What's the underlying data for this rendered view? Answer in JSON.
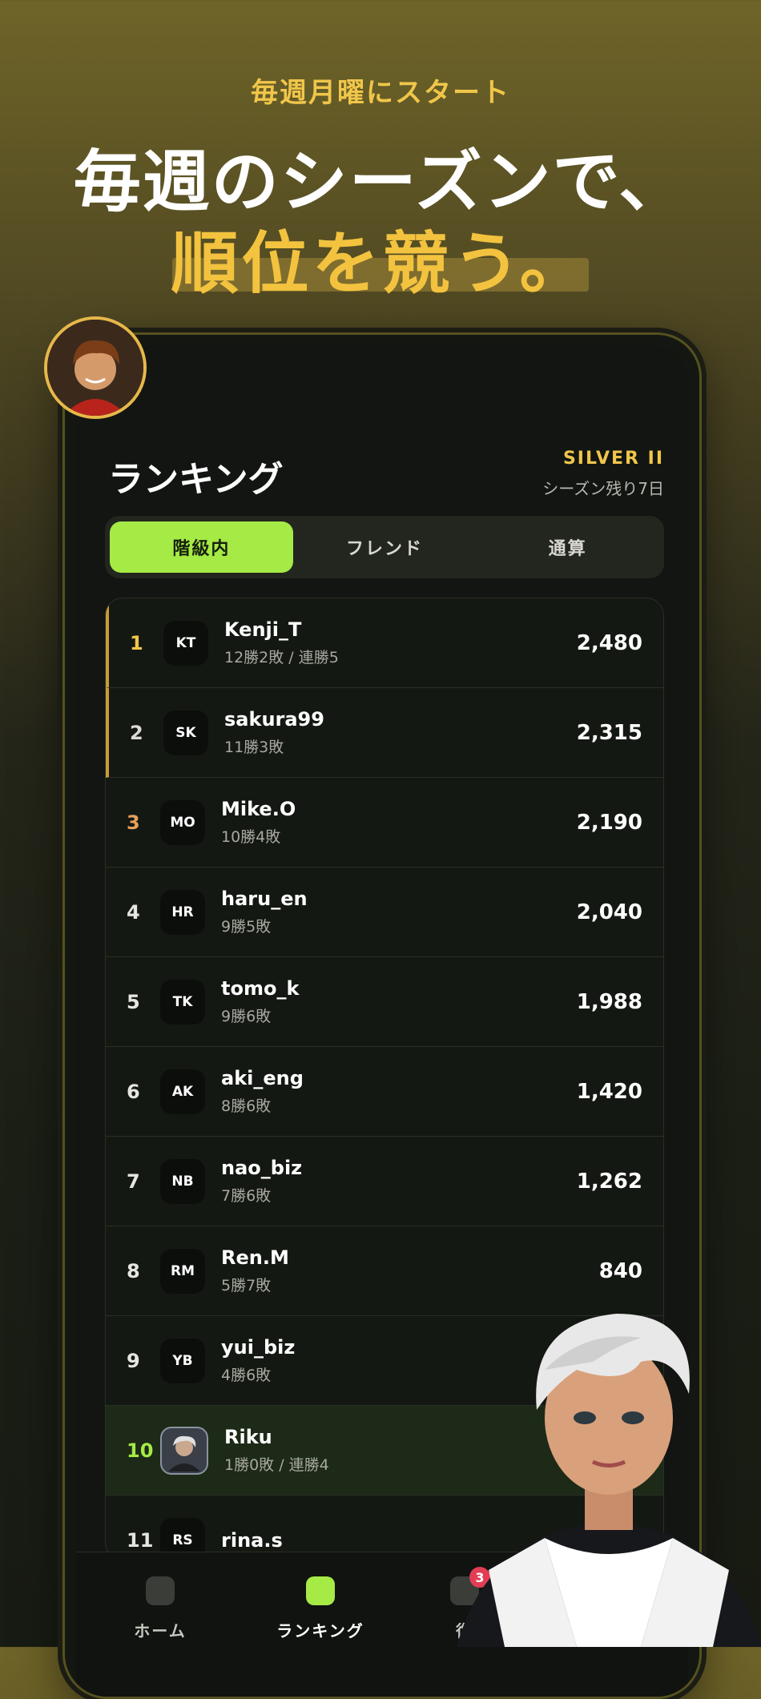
{
  "promo": {
    "tagline": "毎週月曜にスタート",
    "headline1": "毎週のシーズンで、",
    "headline2": "順位を競う。"
  },
  "screen": {
    "title": "ランキング",
    "rank_badge": "SILVER II",
    "season_text": "シーズン残り7日",
    "tabs": [
      "階級内",
      "フレンド",
      "通算"
    ],
    "active_tab": "階級内"
  },
  "rows": [
    {
      "rank": "1",
      "initials": "KT",
      "name": "Kenji_T",
      "record": "12勝2敗 / 連勝5",
      "score": "2,480"
    },
    {
      "rank": "2",
      "initials": "SK",
      "name": "sakura99",
      "record": "11勝3敗",
      "score": "2,315"
    },
    {
      "rank": "3",
      "initials": "MO",
      "name": "Mike.O",
      "record": "10勝4敗",
      "score": "2,190"
    },
    {
      "rank": "4",
      "initials": "HR",
      "name": "haru_en",
      "record": "9勝5敗",
      "score": "2,040"
    },
    {
      "rank": "5",
      "initials": "TK",
      "name": "tomo_k",
      "record": "9勝6敗",
      "score": "1,988"
    },
    {
      "rank": "6",
      "initials": "AK",
      "name": "aki_eng",
      "record": "8勝6敗",
      "score": "1,420"
    },
    {
      "rank": "7",
      "initials": "NB",
      "name": "nao_biz",
      "record": "7勝6敗",
      "score": "1,262"
    },
    {
      "rank": "8",
      "initials": "RM",
      "name": "Ren.M",
      "record": "5勝7敗",
      "score": "840"
    },
    {
      "rank": "9",
      "initials": "YB",
      "name": "yui_biz",
      "record": "4勝6敗",
      "score": ""
    },
    {
      "rank": "10",
      "initials": "",
      "name": "Riku",
      "record": "1勝0敗 / 連勝4",
      "score": ""
    },
    {
      "rank": "11",
      "initials": "RS",
      "name": "rina.s",
      "record": "",
      "score": ""
    }
  ],
  "nav": {
    "items": [
      "ホーム",
      "ランキング",
      "復"
    ],
    "active": "ランキング",
    "badge_count": "3"
  },
  "colors": {
    "accent": "#a6ea45",
    "gold": "#f0c64a",
    "badge": "#e23d55"
  }
}
